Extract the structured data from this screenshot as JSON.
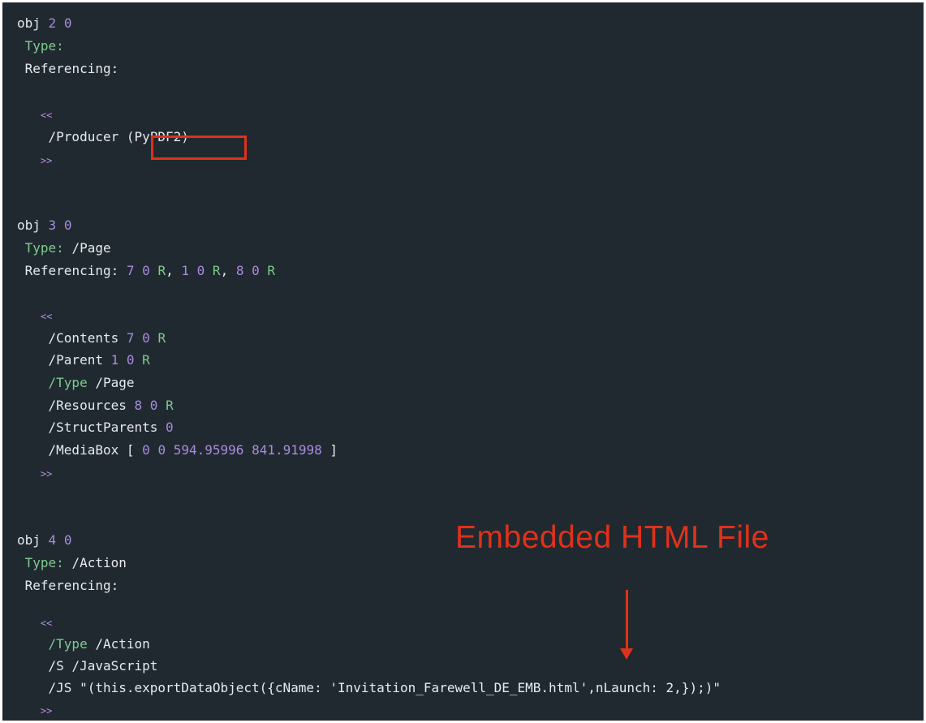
{
  "obj2": {
    "header": {
      "kw": "obj",
      "id": "2",
      "gen": "0"
    },
    "type_label": "Type:",
    "referencing_label": "Referencing:",
    "open": "<<",
    "producer_key": "/Producer",
    "producer_value": "(PyPDF2)",
    "close": ">>"
  },
  "obj3": {
    "header": {
      "kw": "obj",
      "id": "3",
      "gen": "0"
    },
    "type_label": "Type:",
    "type_value": "/Page",
    "referencing_label": "Referencing:",
    "refs": [
      {
        "id": "7",
        "gen": "0",
        "r": "R",
        "sep": ","
      },
      {
        "id": "1",
        "gen": "0",
        "r": "R",
        "sep": ","
      },
      {
        "id": "8",
        "gen": "0",
        "r": "R",
        "sep": ""
      }
    ],
    "open": "<<",
    "contents": {
      "key": "/Contents",
      "id": "7",
      "gen": "0",
      "r": "R"
    },
    "parent": {
      "key": "/Parent",
      "id": "1",
      "gen": "0",
      "r": "R"
    },
    "type_entry": {
      "key": "/Type",
      "value": "/Page"
    },
    "resources": {
      "key": "/Resources",
      "id": "8",
      "gen": "0",
      "r": "R"
    },
    "structparents": {
      "key": "/StructParents",
      "value": "0"
    },
    "mediabox": {
      "key": "/MediaBox",
      "open": "[",
      "v1": "0",
      "v2": "0",
      "v3": "594.95996",
      "v4": "841.91998",
      "close": "]"
    },
    "close": ">>"
  },
  "obj4": {
    "header": {
      "kw": "obj",
      "id": "4",
      "gen": "0"
    },
    "type_label": "Type:",
    "type_value": "/Action",
    "referencing_label": "Referencing:",
    "open": "<<",
    "type_entry": {
      "key": "/Type",
      "value": "/Action"
    },
    "s_entry": {
      "key": "/S",
      "value": "/JavaScript"
    },
    "js_entry": {
      "key": "/JS",
      "value": "\"(this.exportDataObject({cName: 'Invitation_Farewell_DE_EMB.html',nLaunch: 2,});)\""
    },
    "close": ">>"
  },
  "annotation": {
    "text": "Embedded HTML File",
    "color": "#e0311a"
  },
  "colors": {
    "background": "#20292f",
    "text": "#e6eaee",
    "keyword_green": "#7ecb8f",
    "number_purple": "#a98be0"
  }
}
